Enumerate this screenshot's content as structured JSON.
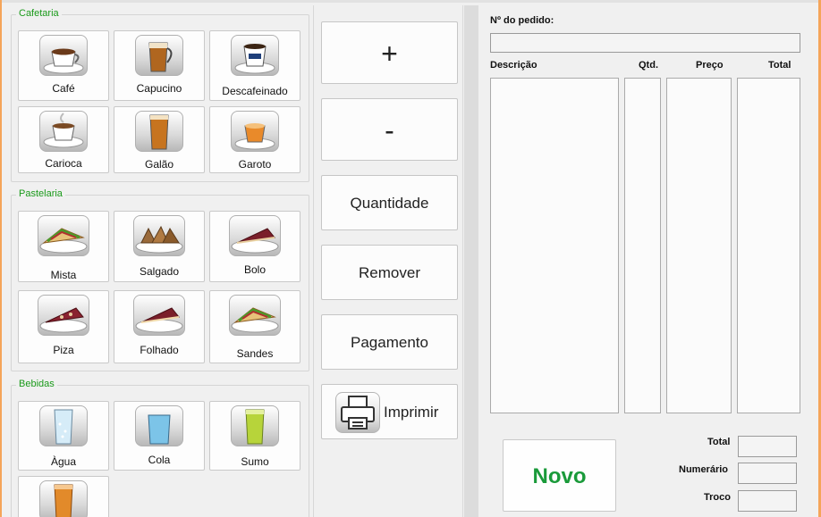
{
  "cafetaria": {
    "title": "Cafetaria",
    "items": [
      {
        "label": "Café",
        "icon": "coffee-cup-icon"
      },
      {
        "label": "Capucino",
        "icon": "cappuccino-glass-icon"
      },
      {
        "label": "Descafeinado",
        "icon": "decaf-cup-icon"
      },
      {
        "label": "Carioca",
        "icon": "carioca-cup-icon"
      },
      {
        "label": "Galão",
        "icon": "galao-glass-icon"
      },
      {
        "label": "Garoto",
        "icon": "garoto-cup-icon"
      }
    ]
  },
  "pastelaria": {
    "title": "Pastelaria",
    "items": [
      {
        "label": "Mista",
        "icon": "sandwich-icon"
      },
      {
        "label": "Salgado",
        "icon": "savory-pastry-icon"
      },
      {
        "label": "Bolo",
        "icon": "cake-icon"
      },
      {
        "label": "Piza",
        "icon": "pizza-slice-icon"
      },
      {
        "label": "Folhado",
        "icon": "puff-pastry-icon"
      },
      {
        "label": "Sandes",
        "icon": "sandwich-icon"
      }
    ]
  },
  "bebidas": {
    "title": "Bebidas",
    "items": [
      {
        "label": "Àgua",
        "icon": "water-glass-icon"
      },
      {
        "label": "Cola",
        "icon": "cola-glass-icon"
      },
      {
        "label": "Sumo",
        "icon": "juice-glass-icon"
      },
      {
        "label": "",
        "icon": "orange-juice-glass-icon"
      }
    ]
  },
  "actions": {
    "plus": "+",
    "minus": "-",
    "quantity": "Quantidade",
    "remove": "Remover",
    "payment": "Pagamento",
    "print": "Imprimir"
  },
  "order": {
    "number_label": "Nº do pedido:",
    "number_value": "",
    "col_description": "Descrição",
    "col_qty": "Qtd.",
    "col_price": "Preço",
    "col_total": "Total",
    "total_label": "Total",
    "cash_label": "Numerário",
    "change_label": "Troco",
    "total_value": "",
    "cash_value": "",
    "change_value": "",
    "new_button": "Novo"
  },
  "colors": {
    "accent_green": "#1a9a3a",
    "group_title_green": "#1a9a1a",
    "window_edge_orange": "#f5a55a"
  }
}
